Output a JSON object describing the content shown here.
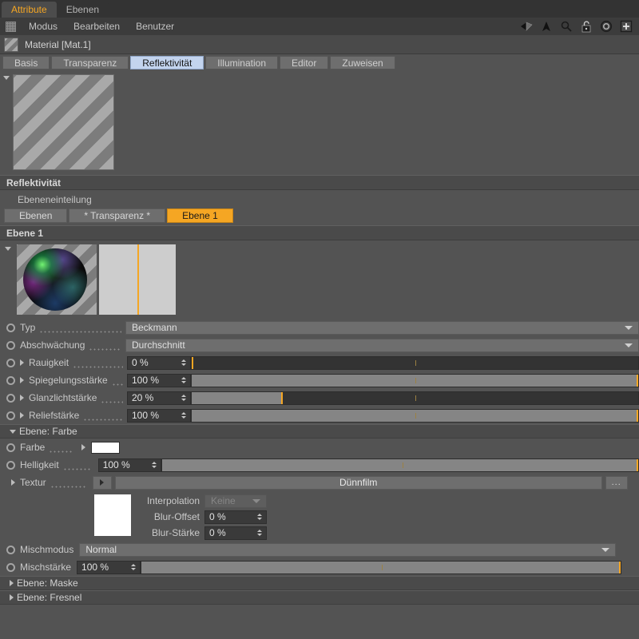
{
  "window": {
    "tabs": [
      {
        "label": "Attribute",
        "selected": true
      },
      {
        "label": "Ebenen",
        "selected": false
      }
    ]
  },
  "menubar": {
    "items": [
      "Modus",
      "Bearbeiten",
      "Benutzer"
    ],
    "icons": [
      "back-arrow-icon",
      "up-arrow-icon",
      "search-icon",
      "lock-icon",
      "target-icon",
      "plus-box-icon"
    ]
  },
  "material": {
    "title": "Material [Mat.1]",
    "tabs": [
      {
        "label": "Basis",
        "selected": false
      },
      {
        "label": "Transparenz",
        "selected": false
      },
      {
        "label": "Reflektivität",
        "selected": true
      },
      {
        "label": "Illumination",
        "selected": false
      },
      {
        "label": "Editor",
        "selected": false
      },
      {
        "label": "Zuweisen",
        "selected": false
      }
    ]
  },
  "reflectivity": {
    "section_title": "Reflektivität",
    "grouping_label": "Ebeneneinteilung",
    "group_buttons": [
      {
        "label": "Ebenen",
        "selected": false
      },
      {
        "label": "* Transparenz *",
        "selected": false
      },
      {
        "label": "Ebene 1",
        "selected": true
      }
    ],
    "layer_title": "Ebene 1"
  },
  "params": [
    {
      "name": "Typ",
      "type": "combo",
      "value": "Beckmann"
    },
    {
      "name": "Abschwächung",
      "type": "combo",
      "value": "Durchschnitt"
    },
    {
      "name": "Rauigkeit",
      "type": "slider",
      "value": "0 %",
      "percent": 0
    },
    {
      "name": "Spiegelungsstärke",
      "type": "slider",
      "value": "100 %",
      "percent": 100
    },
    {
      "name": "Glanzlichtstärke",
      "type": "slider",
      "value": "20 %",
      "percent": 20
    },
    {
      "name": "Reliefstärke",
      "type": "slider",
      "value": "100 %",
      "percent": 100
    }
  ],
  "layer_color": {
    "title": "Ebene: Farbe",
    "color_label": "Farbe",
    "color_value": "#ffffff",
    "brightness_label": "Helligkeit",
    "brightness_value": "100 %",
    "brightness_percent": 100,
    "texture_label": "Textur",
    "texture_name": "Dünnfilm",
    "texture_more": "...",
    "interpolation_label": "Interpolation",
    "interpolation_value": "Keine",
    "blur_offset_label": "Blur-Offset",
    "blur_offset_value": "0 %",
    "blur_strength_label": "Blur-Stärke",
    "blur_strength_value": "0 %"
  },
  "mixing": {
    "mode_label": "Mischmodus",
    "mode_value": "Normal",
    "strength_label": "Mischstärke",
    "strength_value": "100 %",
    "strength_percent": 100
  },
  "collapsed_sections": [
    {
      "title": "Ebene: Maske"
    },
    {
      "title": "Ebene: Fresnel"
    }
  ],
  "colors": {
    "accent_orange": "#f5a623",
    "tab_selected_blue": "#c3d4ee",
    "panel_bg": "#535353",
    "header_bg": "#4a4a4a"
  }
}
